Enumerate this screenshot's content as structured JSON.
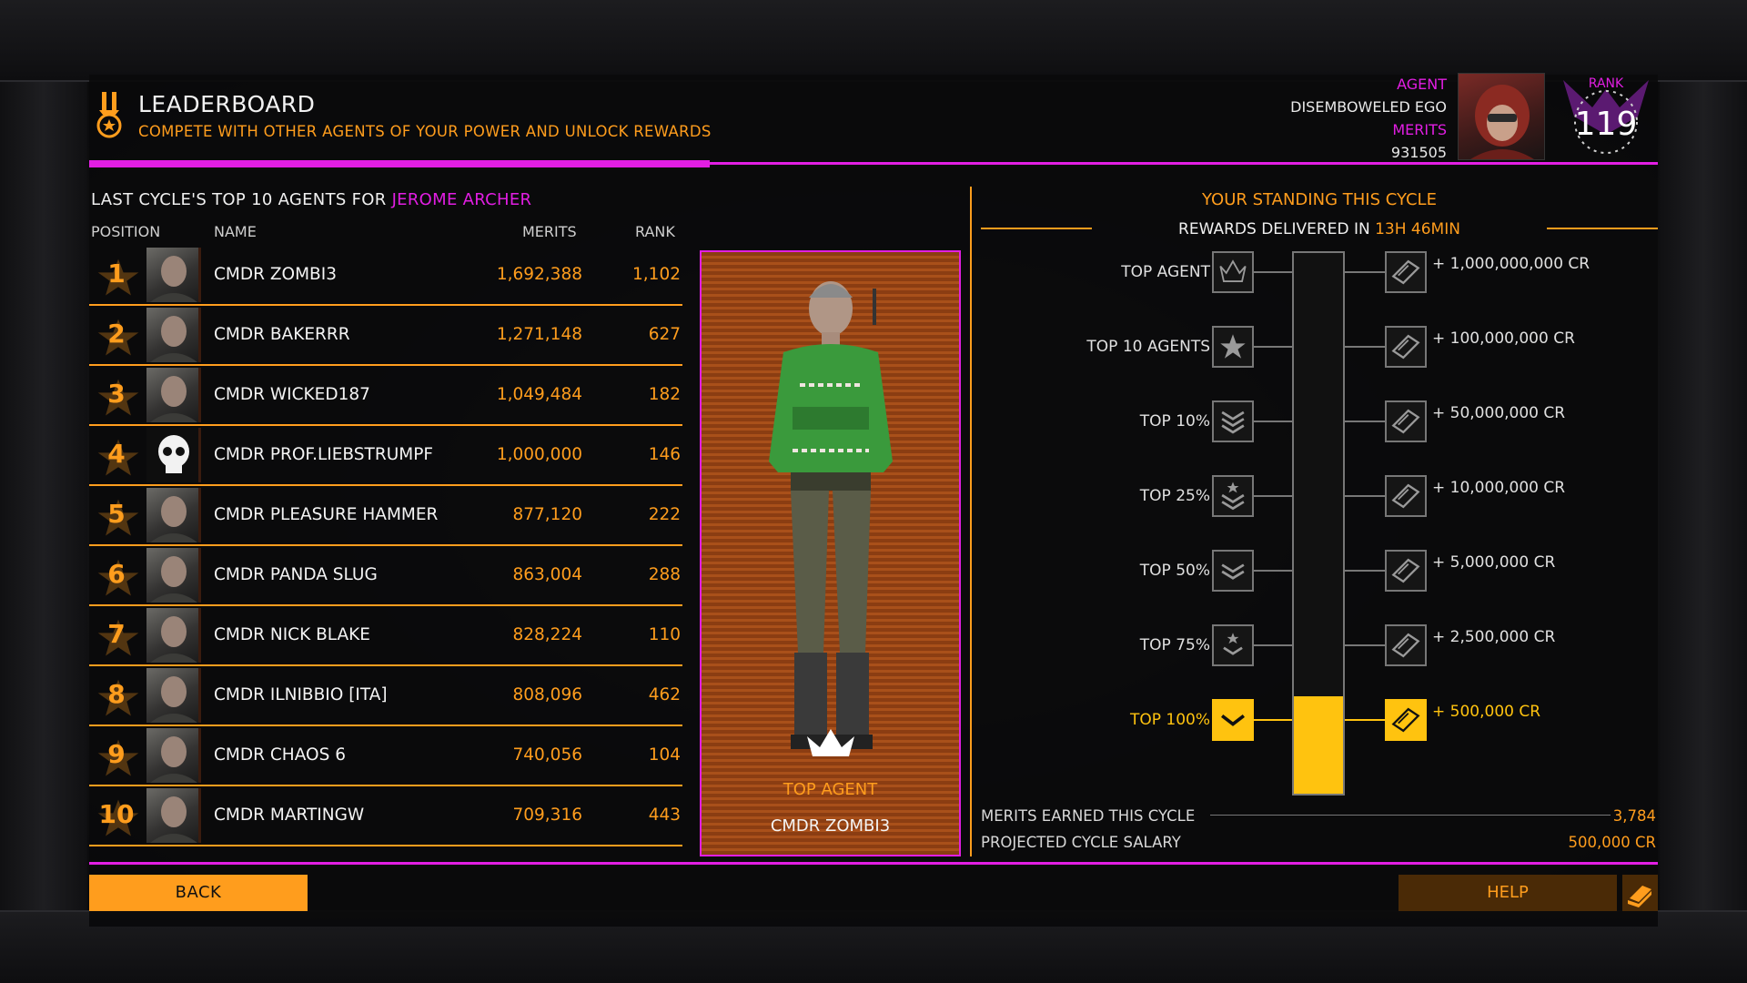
{
  "header": {
    "title": "LEADERBOARD",
    "subtitle": "COMPETE WITH OTHER AGENTS OF YOUR POWER AND UNLOCK REWARDS",
    "icon": "medal-icon"
  },
  "agent": {
    "agent_label": "AGENT",
    "agent_name": "DISEMBOWELED EGO",
    "merits_label": "MERITS",
    "merits_value": "931505",
    "rank_label": "RANK",
    "rank_value": "119"
  },
  "leaderboard": {
    "title_prefix": "LAST CYCLE'S TOP 10 AGENTS FOR ",
    "power_name": "JEROME ARCHER",
    "columns": {
      "position": "POSITION",
      "name": "NAME",
      "merits": "MERITS",
      "rank": "RANK"
    },
    "rows": [
      {
        "pos": "1",
        "name": "CMDR ZOMBI3",
        "merits": "1,692,388",
        "rank": "1,102"
      },
      {
        "pos": "2",
        "name": "CMDR BAKERRR",
        "merits": "1,271,148",
        "rank": "627"
      },
      {
        "pos": "3",
        "name": "CMDR WICKED187",
        "merits": "1,049,484",
        "rank": "182"
      },
      {
        "pos": "4",
        "name": "CMDR PROF.LIEBSTRUMPF",
        "merits": "1,000,000",
        "rank": "146"
      },
      {
        "pos": "5",
        "name": "CMDR PLEASURE HAMMER",
        "merits": "877,120",
        "rank": "222"
      },
      {
        "pos": "6",
        "name": "CMDR PANDA SLUG",
        "merits": "863,004",
        "rank": "288"
      },
      {
        "pos": "7",
        "name": "CMDR NICK BLAKE",
        "merits": "828,224",
        "rank": "110"
      },
      {
        "pos": "8",
        "name": "CMDR ILNIBBIO [ITA]",
        "merits": "808,096",
        "rank": "462"
      },
      {
        "pos": "9",
        "name": "CMDR CHAOS 6",
        "merits": "740,056",
        "rank": "104"
      },
      {
        "pos": "10",
        "name": "CMDR MARTINGW",
        "merits": "709,316",
        "rank": "443"
      }
    ]
  },
  "feature": {
    "tag": "TOP AGENT",
    "name": "CMDR ZOMBI3"
  },
  "standing": {
    "title": "YOUR STANDING THIS CYCLE",
    "delivered_label": "REWARDS DELIVERED IN ",
    "delivered_time": "13H 46MIN",
    "tiers": [
      {
        "label": "TOP AGENT",
        "reward": "+ 1,000,000,000 CR",
        "icon": "crown-icon",
        "achieved": false
      },
      {
        "label": "TOP 10 AGENTS",
        "reward": "+ 100,000,000 CR",
        "icon": "star-icon",
        "achieved": false
      },
      {
        "label": "TOP 10%",
        "reward": "+ 50,000,000 CR",
        "icon": "triple-chevron-icon",
        "achieved": false
      },
      {
        "label": "TOP 25%",
        "reward": "+ 10,000,000 CR",
        "icon": "double-chevron-star-icon",
        "achieved": false
      },
      {
        "label": "TOP 50%",
        "reward": "+ 5,000,000 CR",
        "icon": "double-chevron-icon",
        "achieved": false
      },
      {
        "label": "TOP 75%",
        "reward": "+ 2,500,000 CR",
        "icon": "chevron-star-icon",
        "achieved": false
      },
      {
        "label": "TOP 100%",
        "reward": "+ 500,000 CR",
        "icon": "chevron-icon",
        "achieved": true
      }
    ],
    "progress_fraction": 0.18,
    "merits_label": "MERITS EARNED THIS CYCLE",
    "merits_value": "3,784",
    "salary_label": "PROJECTED CYCLE SALARY",
    "salary_value": "500,000 CR"
  },
  "buttons": {
    "back": "BACK",
    "help": "HELP"
  },
  "colors": {
    "accent": "#ff9d1d",
    "highlight": "#e21ee3",
    "achieved": "#ffc30f"
  }
}
